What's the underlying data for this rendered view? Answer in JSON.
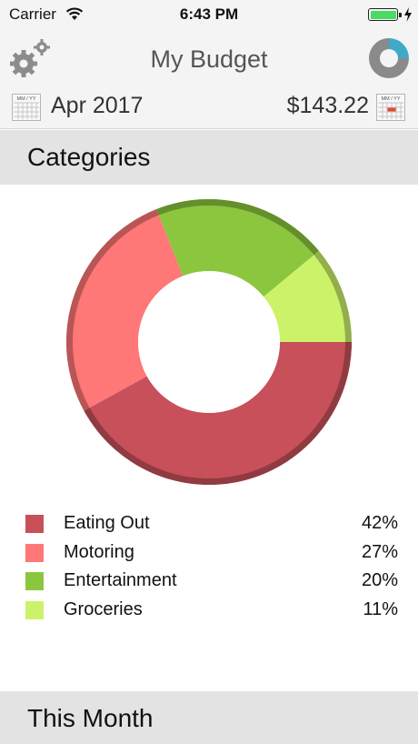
{
  "status_bar": {
    "carrier": "Carrier",
    "time": "6:43 PM"
  },
  "header": {
    "title": "My Budget",
    "month": "Apr 2017",
    "total": "$143.22",
    "calendar_label": "MM / YY",
    "left_icon": "gear-icon",
    "right_icon": "donut-chart-icon"
  },
  "sections": {
    "categories": "Categories",
    "this_month": "This Month"
  },
  "colors": {
    "eating_out": "#c8505a",
    "motoring": "#ff7777",
    "entertainment": "#8cc63f",
    "groceries": "#ccf26a"
  },
  "legend": [
    {
      "name": "Eating Out",
      "percent": "42%"
    },
    {
      "name": "Motoring",
      "percent": "27%"
    },
    {
      "name": "Entertainment",
      "percent": "20%"
    },
    {
      "name": "Groceries",
      "percent": "11%"
    }
  ],
  "chart_data": {
    "type": "pie",
    "categories": [
      "Eating Out",
      "Motoring",
      "Entertainment",
      "Groceries"
    ],
    "values": [
      42,
      27,
      20,
      11
    ],
    "title": "",
    "donut": true
  }
}
